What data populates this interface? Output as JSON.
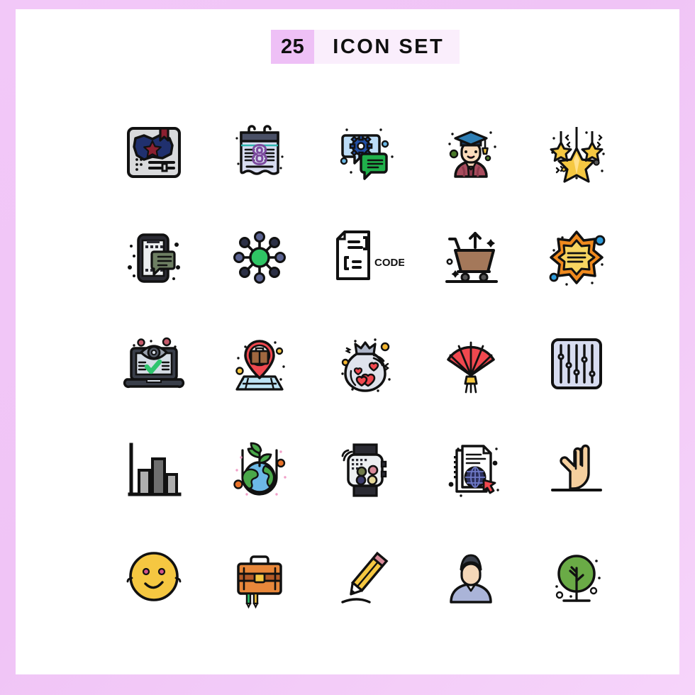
{
  "page": {
    "background_color": "#f0c8f5",
    "canvas_color": "#ffffff"
  },
  "header": {
    "count": "25",
    "title": "ICON SET",
    "count_badge_color": "#eec0f6",
    "title_box_color": "#faeefc",
    "text_color": "#101010"
  },
  "grid": {
    "columns": 5,
    "rows": 5,
    "total_icons": 25,
    "icons": [
      {
        "id": "usa-map-bookmark",
        "name": "usa-map-bookmark-icon",
        "row": 1,
        "col": 1,
        "label": "United States map with star and bookmark",
        "colors": [
          "#1f2a63",
          "#8c2030",
          "#d8d8d8",
          "#111111"
        ]
      },
      {
        "id": "calendar-8",
        "name": "calendar-date-8-icon",
        "row": 1,
        "col": 2,
        "label": "Calendar showing number 8",
        "colors": [
          "#4a5066",
          "#d7dcf0",
          "#7c4b9e",
          "#111111"
        ]
      },
      {
        "id": "chat-settings",
        "name": "chat-settings-gear-icon",
        "row": 1,
        "col": 3,
        "label": "Chat bubbles with gear",
        "colors": [
          "#bcdcf7",
          "#20b04b",
          "#2250a8",
          "#111111"
        ]
      },
      {
        "id": "graduate-student",
        "name": "graduate-student-icon",
        "row": 1,
        "col": 4,
        "label": "Graduate student with cap",
        "colors": [
          "#1d3a5c",
          "#2f7fb5",
          "#f5d7b8",
          "#a84d5e",
          "#111111"
        ]
      },
      {
        "id": "hanging-stars",
        "name": "hanging-stars-decoration-icon",
        "row": 1,
        "col": 5,
        "label": "Hanging star decorations",
        "colors": [
          "#f5c842",
          "#ffe08a",
          "#111111"
        ]
      },
      {
        "id": "mobile-chat",
        "name": "mobile-chat-message-icon",
        "row": 2,
        "col": 1,
        "label": "Smartphone with chat message",
        "colors": [
          "#2b2b33",
          "#e8eaed",
          "#6e7f63",
          "#111111"
        ]
      },
      {
        "id": "network-nodes",
        "name": "network-nodes-icon",
        "row": 2,
        "col": 2,
        "label": "Network of connected nodes",
        "colors": [
          "#2fc464",
          "#2b2f45",
          "#5b6391",
          "#111111"
        ]
      },
      {
        "id": "code-file",
        "name": "code-file-icon",
        "row": 2,
        "col": 3,
        "label": "Document file labelled CODE",
        "text": "CODE",
        "colors": [
          "#111111",
          "#ffffff"
        ]
      },
      {
        "id": "cart-upload",
        "name": "shopping-cart-upload-icon",
        "row": 2,
        "col": 4,
        "label": "Shopping cart with up arrow",
        "colors": [
          "#a4785a",
          "#111111"
        ]
      },
      {
        "id": "badge-star-burst",
        "name": "starburst-badge-icon",
        "row": 2,
        "col": 5,
        "label": "Eight point starburst badge",
        "colors": [
          "#f08a1e",
          "#f7d560",
          "#2d9bdb",
          "#111111"
        ]
      },
      {
        "id": "laptop-secure",
        "name": "laptop-verified-eye-icon",
        "row": 3,
        "col": 1,
        "label": "Laptop with eye and check mark",
        "colors": [
          "#3a3f4a",
          "#d6dde6",
          "#2fc46e",
          "#c45a6a",
          "#111111"
        ]
      },
      {
        "id": "job-location",
        "name": "job-location-pin-icon",
        "row": 3,
        "col": 2,
        "label": "Map pin with briefcase",
        "colors": [
          "#f0484f",
          "#a0673f",
          "#bde4f5",
          "#f5c741",
          "#111111"
        ]
      },
      {
        "id": "love-bag",
        "name": "love-gift-bag-icon",
        "row": 3,
        "col": 3,
        "label": "Gift bag with hearts",
        "colors": [
          "#dfe3ec",
          "#f0484f",
          "#f5b731",
          "#111111"
        ]
      },
      {
        "id": "hand-fan",
        "name": "chinese-hand-fan-icon",
        "row": 3,
        "col": 4,
        "label": "Red folding hand fan",
        "colors": [
          "#f0484f",
          "#f5c741",
          "#111111"
        ]
      },
      {
        "id": "equalizer",
        "name": "equalizer-settings-icon",
        "row": 3,
        "col": 5,
        "label": "Equalizer sliders panel",
        "colors": [
          "#d7dcf0",
          "#111111"
        ]
      },
      {
        "id": "bar-chart",
        "name": "bar-chart-icon",
        "row": 4,
        "col": 1,
        "label": "Bar chart statistics",
        "colors": [
          "#6f6f6f",
          "#aeaeae",
          "#111111"
        ]
      },
      {
        "id": "eco-earth-plant",
        "name": "eco-earth-plant-icon",
        "row": 4,
        "col": 2,
        "label": "Earth globe with sprouting plant",
        "colors": [
          "#4aa84a",
          "#5fb85f",
          "#6cb8e6",
          "#e8722a",
          "#111111"
        ]
      },
      {
        "id": "smart-watch",
        "name": "smart-watch-icon",
        "row": 4,
        "col": 3,
        "label": "Smart watch with signal",
        "colors": [
          "#2b2b33",
          "#eceff2",
          "#6f7a4a",
          "#d88a9a",
          "#3b3b6b",
          "#e6d89a",
          "#111111"
        ]
      },
      {
        "id": "web-documents",
        "name": "web-documents-globe-icon",
        "row": 4,
        "col": 4,
        "label": "Documents with globe and cursor",
        "colors": [
          "#ffffff",
          "#2b2f5c",
          "#4a5aa8",
          "#f0484f",
          "#111111"
        ]
      },
      {
        "id": "open-hand",
        "name": "open-hand-icon",
        "row": 4,
        "col": 5,
        "label": "Open raised hand",
        "colors": [
          "#f5cf9e",
          "#111111"
        ]
      },
      {
        "id": "smiley-face",
        "name": "smiley-emoji-icon",
        "row": 5,
        "col": 1,
        "label": "Smiling emoji face",
        "colors": [
          "#f5c741",
          "#111111"
        ]
      },
      {
        "id": "briefcase",
        "name": "briefcase-icon",
        "row": 5,
        "col": 2,
        "label": "Briefcase with pencils",
        "colors": [
          "#e8873a",
          "#b35a28",
          "#2fc46e",
          "#f5c741",
          "#111111"
        ]
      },
      {
        "id": "pencil",
        "name": "pencil-edit-icon",
        "row": 5,
        "col": 3,
        "label": "Pencil writing",
        "colors": [
          "#f5c741",
          "#d88a9a",
          "#111111"
        ]
      },
      {
        "id": "user-avatar",
        "name": "user-avatar-icon",
        "row": 5,
        "col": 4,
        "label": "User profile avatar",
        "colors": [
          "#3a3f4a",
          "#f5d7b8",
          "#aab4d8",
          "#111111"
        ]
      },
      {
        "id": "tree",
        "name": "tree-icon",
        "row": 5,
        "col": 5,
        "label": "Green tree",
        "colors": [
          "#6aab46",
          "#111111"
        ]
      }
    ]
  }
}
